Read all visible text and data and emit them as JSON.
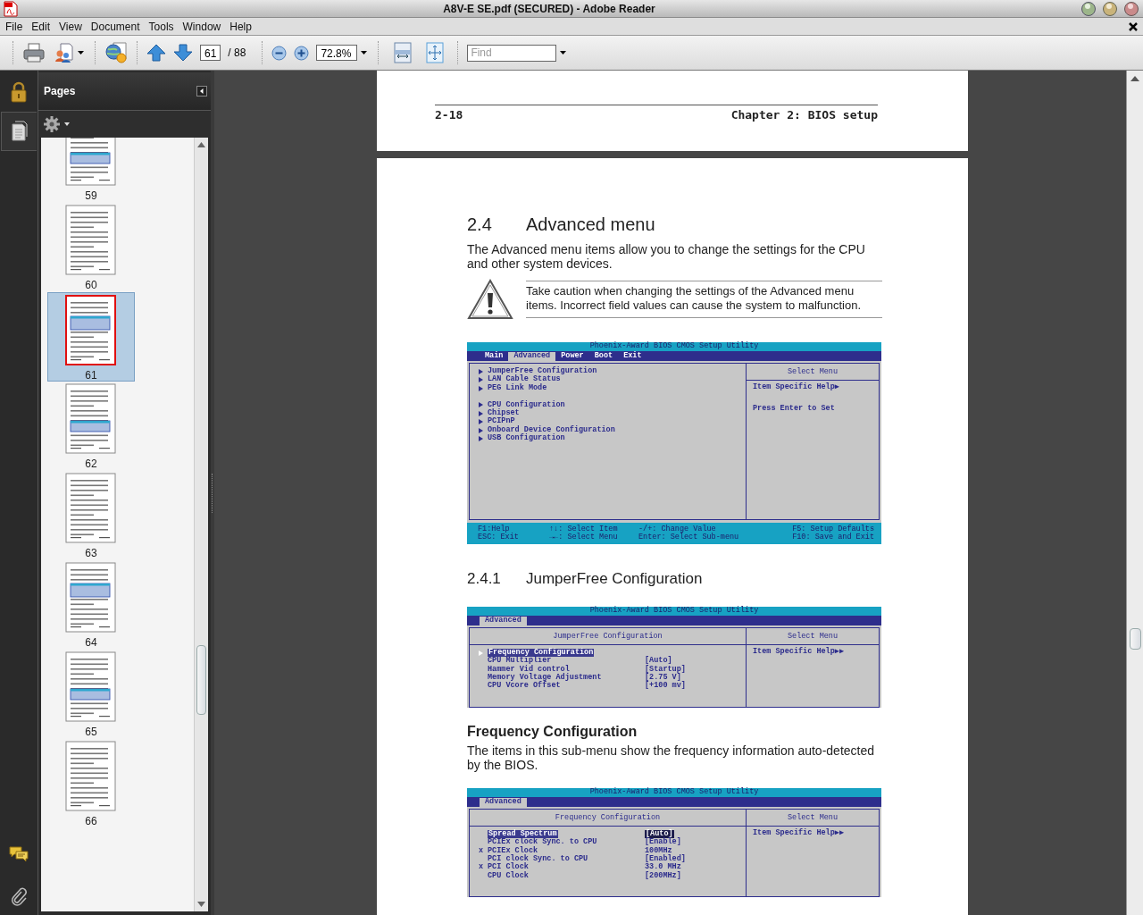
{
  "window": {
    "title": "A8V-E SE.pdf (SECURED) - Adobe Reader"
  },
  "menu": [
    "File",
    "Edit",
    "View",
    "Document",
    "Tools",
    "Window",
    "Help"
  ],
  "toolbar": {
    "page_number": "61",
    "page_count": "/ 88",
    "zoom": "72.8%",
    "find_placeholder": "Find"
  },
  "pages_panel": {
    "title": "Pages",
    "thumbnails": [
      {
        "label": "59",
        "selected": false
      },
      {
        "label": "60",
        "selected": false
      },
      {
        "label": "61",
        "selected": true
      },
      {
        "label": "62",
        "selected": false
      },
      {
        "label": "63",
        "selected": false
      },
      {
        "label": "64",
        "selected": false
      },
      {
        "label": "65",
        "selected": false
      },
      {
        "label": "66",
        "selected": false
      }
    ]
  },
  "document": {
    "running_header": {
      "page": "2-18",
      "chapter": "Chapter 2: BIOS setup"
    },
    "content": [
      {
        "kind": "section",
        "number": "2.4",
        "text": "Advanced menu"
      },
      {
        "kind": "paragraph",
        "text": "The Advanced menu items allow you to change the settings for the CPU and other system devices."
      },
      {
        "kind": "caution",
        "text": "Take caution when changing the settings of the Advanced menu items. Incorrect field values can cause the system to malfunction."
      },
      {
        "kind": "bios",
        "title": "Phoenix-Award BIOS CMOS Setup Utility",
        "tabs": [
          {
            "label": "Main",
            "selected": false
          },
          {
            "label": "Advanced",
            "selected": true
          },
          {
            "label": "Power",
            "selected": false
          },
          {
            "label": "Boot",
            "selected": false
          },
          {
            "label": "Exit",
            "selected": false
          }
        ],
        "help_title": "Select Menu",
        "item_groups": [
          [
            {
              "label": "JumperFree Configuration",
              "submenu": true,
              "selected": false
            },
            {
              "label": "LAN Cable Status",
              "submenu": true,
              "selected": false
            },
            {
              "label": "PEG Link Mode",
              "submenu": true,
              "selected": false
            }
          ],
          [
            {
              "label": "CPU Configuration",
              "submenu": true,
              "selected": false
            },
            {
              "label": "Chipset",
              "submenu": true,
              "selected": false
            },
            {
              "label": "PCIPnP",
              "submenu": true,
              "selected": false
            },
            {
              "label": "Onboard Device Configuration",
              "submenu": true,
              "selected": false
            },
            {
              "label": "USB Configuration",
              "submenu": true,
              "selected": false
            }
          ]
        ],
        "help": [
          "Item Specific Help▶",
          "Press Enter to Set"
        ],
        "footer": [
          [
            "F1:Help",
            "↑↓: Select Item",
            "-/+: Change Value",
            "F5: Setup Defaults"
          ],
          [
            "ESC: Exit",
            "→←: Select Menu",
            "Enter: Select Sub-menu",
            "F10: Save and Exit"
          ]
        ]
      },
      {
        "kind": "subsection",
        "number": "2.4.1",
        "text": "JumperFree Configuration"
      },
      {
        "kind": "bios",
        "title": "Phoenix-Award BIOS CMOS Setup Utility",
        "tabs": [
          {
            "label": "Advanced",
            "selected": true
          }
        ],
        "panel_title": "JumperFree Configuration",
        "help_title": "Select Menu",
        "item_groups": [
          [
            {
              "label": "Frequency Configuration",
              "submenu": true,
              "selected": true
            },
            {
              "label": "CPU Multiplier",
              "value": "[Auto]",
              "submenu": false,
              "selected": false
            },
            {
              "label": "Hammer Vid control",
              "value": "[Startup]",
              "submenu": false,
              "selected": false
            },
            {
              "label": "Memory Voltage Adjustment",
              "value": "[2.75 V]",
              "submenu": false,
              "selected": false
            },
            {
              "label": "CPU Vcore Offset",
              "value": "[+100 mv]",
              "submenu": false,
              "selected": false
            }
          ]
        ],
        "help": [
          "Item Specific Help▶▶"
        ]
      },
      {
        "kind": "topic",
        "text": "Frequency Configuration"
      },
      {
        "kind": "paragraph",
        "text": "The items in this sub-menu show the frequency information auto-detected by the BIOS."
      },
      {
        "kind": "bios",
        "title": "Phoenix-Award BIOS CMOS Setup Utility",
        "tabs": [
          {
            "label": "Advanced",
            "selected": true
          }
        ],
        "panel_title": "Frequency Configuration",
        "help_title": "Select Menu",
        "item_groups": [
          [
            {
              "label": "Spread Spectrum",
              "value": "[Auto]",
              "submenu": false,
              "selected": true
            },
            {
              "label": "PCIEx clock Sync. to CPU",
              "value": "[Enable]",
              "submenu": false,
              "selected": false
            },
            {
              "label": "PCIEx Clock",
              "value": "100MHz",
              "marker": "x",
              "submenu": false,
              "selected": false
            },
            {
              "label": "PCI clock Sync. to CPU",
              "value": "[Enabled]",
              "submenu": false,
              "selected": false
            },
            {
              "label": "PCI Clock",
              "value": "33.0 MHz",
              "marker": "x",
              "submenu": false,
              "selected": false
            },
            {
              "label": "CPU Clock",
              "value": "[200MHz]",
              "submenu": false,
              "selected": false
            }
          ]
        ],
        "help": [
          "Item Specific Help▶▶"
        ]
      }
    ]
  }
}
